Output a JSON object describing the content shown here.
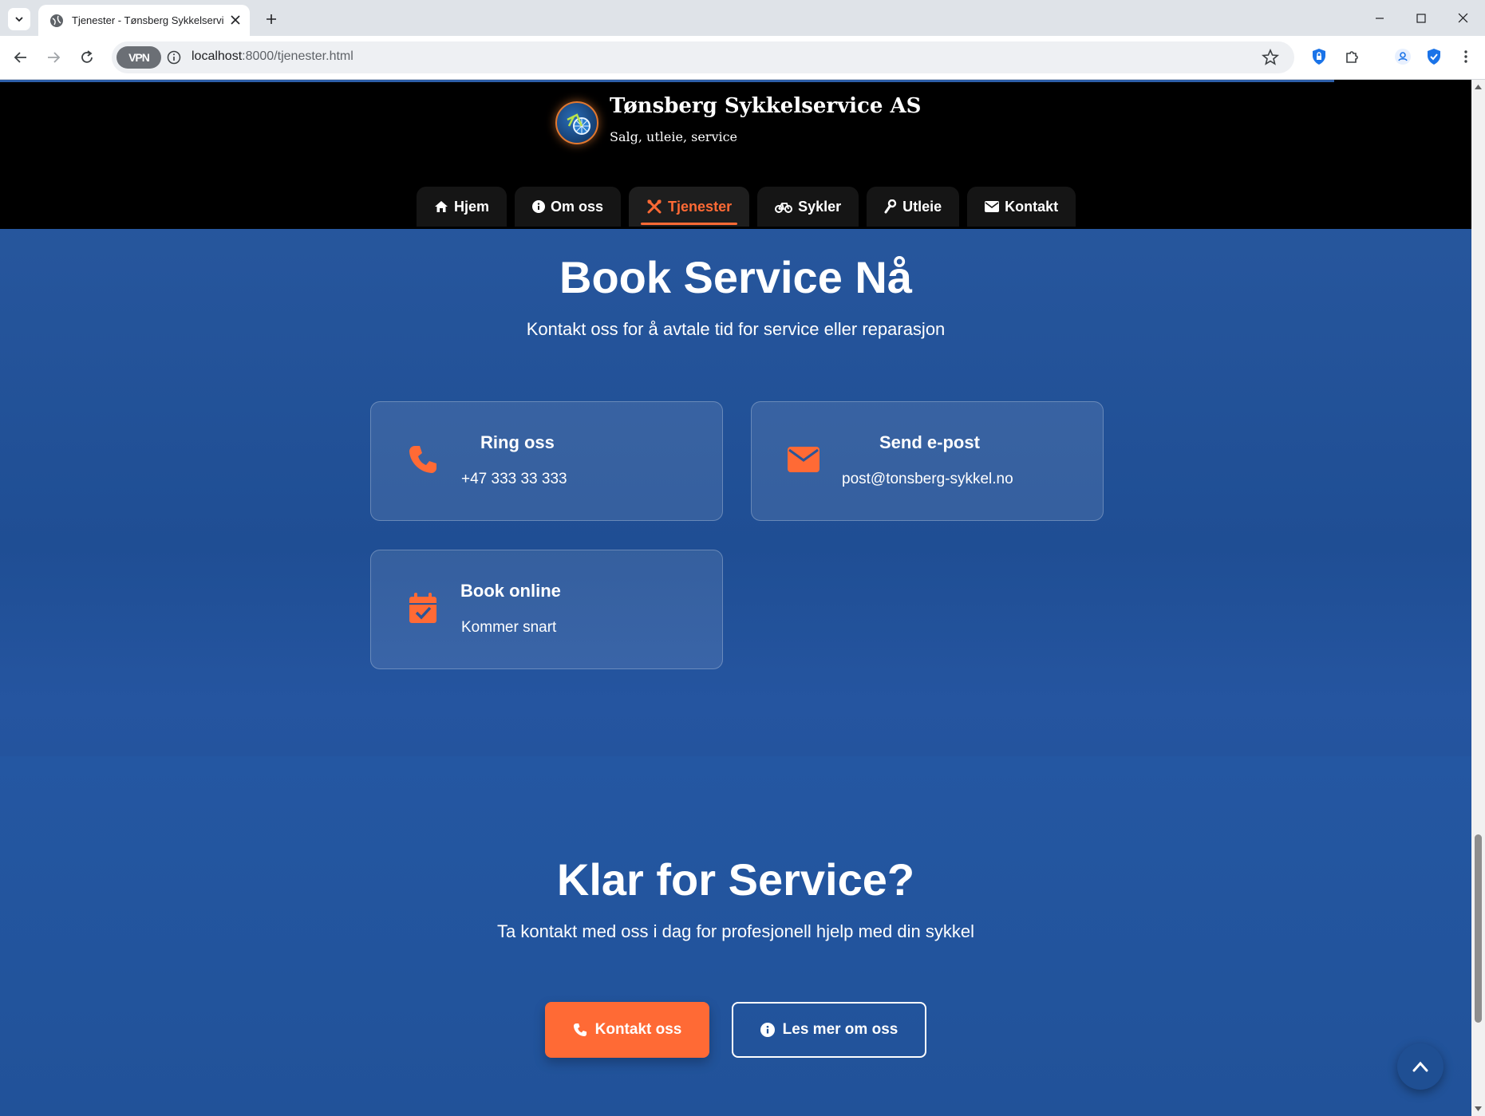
{
  "browser": {
    "tab_title": "Tjenester - Tønsberg Sykkelservice",
    "url_host": "localhost",
    "url_path": ":8000/tjenester.html",
    "vpn_label": "VPN"
  },
  "header": {
    "brand_name": "Tønsberg Sykkelservice AS",
    "tagline": "Salg, utleie, service",
    "nav": [
      {
        "label": "Hjem",
        "icon": "home-icon"
      },
      {
        "label": "Om oss",
        "icon": "info-icon"
      },
      {
        "label": "Tjenester",
        "icon": "tools-icon",
        "active": true
      },
      {
        "label": "Sykler",
        "icon": "bicycle-icon"
      },
      {
        "label": "Utleie",
        "icon": "wrench-icon"
      },
      {
        "label": "Kontakt",
        "icon": "envelope-icon"
      }
    ]
  },
  "book": {
    "title": "Book Service Nå",
    "subtitle": "Kontakt oss for å avtale tid for service eller reparasjon",
    "cards": [
      {
        "title": "Ring oss",
        "value": "+47 333 33 333",
        "icon": "phone-icon"
      },
      {
        "title": "Send e-post",
        "value": "post@tonsberg-sykkel.no",
        "icon": "envelope-icon"
      },
      {
        "title": "Book online",
        "value": "Kommer snart",
        "icon": "calendar-check-icon"
      }
    ]
  },
  "cta": {
    "title": "Klar for Service?",
    "subtitle": "Ta kontakt med oss i dag for profesjonell hjelp med din sykkel",
    "primary_label": "Kontakt oss",
    "secondary_label": "Les mer om oss"
  },
  "colors": {
    "accent": "#ff6a35",
    "page_blue": "#1f4f93",
    "header_bg": "#000000"
  }
}
